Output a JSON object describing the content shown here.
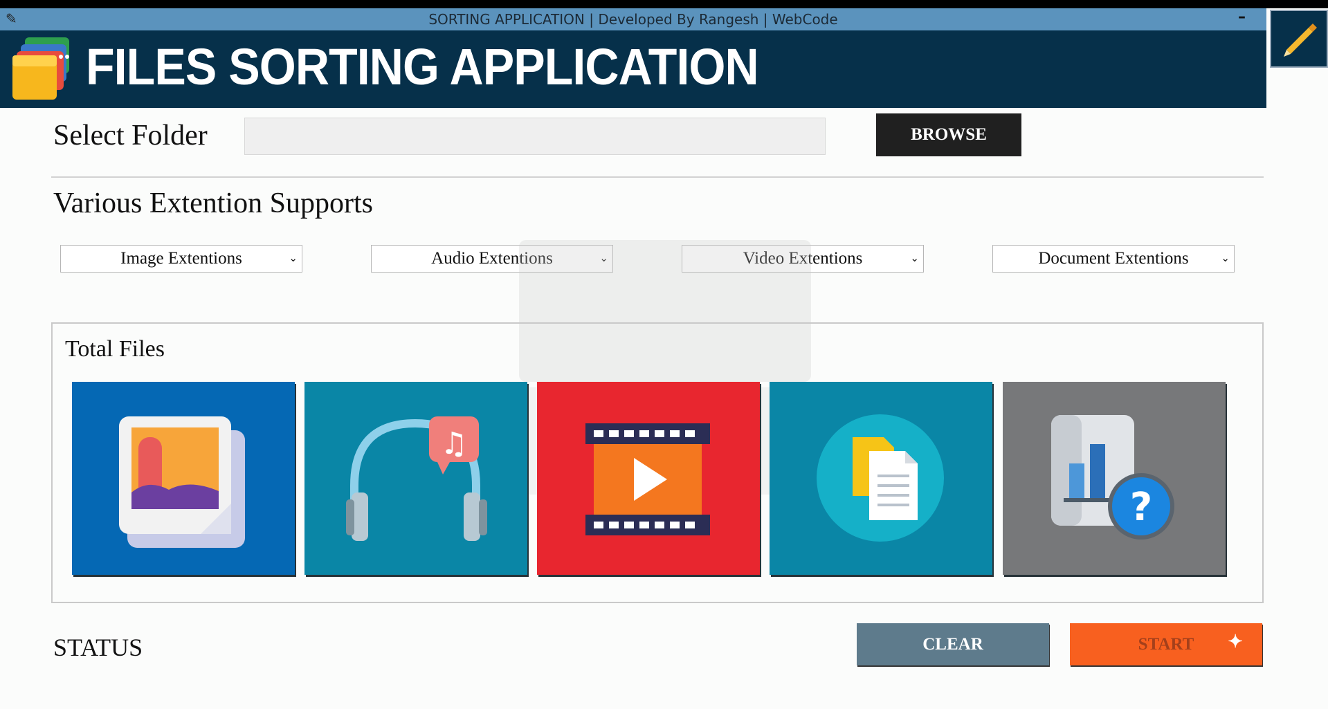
{
  "window": {
    "title": "SORTING APPLICATION | Developed By Rangesh | WebCode",
    "minimize_label": "–"
  },
  "header": {
    "app_title": "FILES SORTING APPLICATION",
    "logo_icon": "folders-icon",
    "corner_icon": "pen-icon"
  },
  "folder": {
    "label": "Select Folder",
    "value": "",
    "browse_label": "BROWSE"
  },
  "extensions": {
    "heading": "Various Extention Supports",
    "dropdowns": [
      {
        "label": "Image Extentions"
      },
      {
        "label": "Audio Extentions"
      },
      {
        "label": "Video Extentions"
      },
      {
        "label": "Document Extentions"
      }
    ]
  },
  "totals": {
    "heading": "Total Files",
    "tiles": [
      {
        "name": "images-tile",
        "icon": "image-icon",
        "color": "#0568b4"
      },
      {
        "name": "audio-tile",
        "icon": "headphones-icon",
        "color": "#0a86a6"
      },
      {
        "name": "video-tile",
        "icon": "video-play-icon",
        "color": "#e8262f"
      },
      {
        "name": "documents-tile",
        "icon": "documents-icon",
        "color": "#0a86a6"
      },
      {
        "name": "others-tile",
        "icon": "unknown-file-icon",
        "color": "#77787a"
      }
    ]
  },
  "footer": {
    "status_label": "STATUS",
    "clear_label": "CLEAR",
    "start_label": "START"
  },
  "colors": {
    "header_bg": "#06304a",
    "titlebar_bg": "#5b93bd",
    "browse_bg": "#202020",
    "clear_bg": "#5e7b8c",
    "start_bg": "#f8601f"
  }
}
